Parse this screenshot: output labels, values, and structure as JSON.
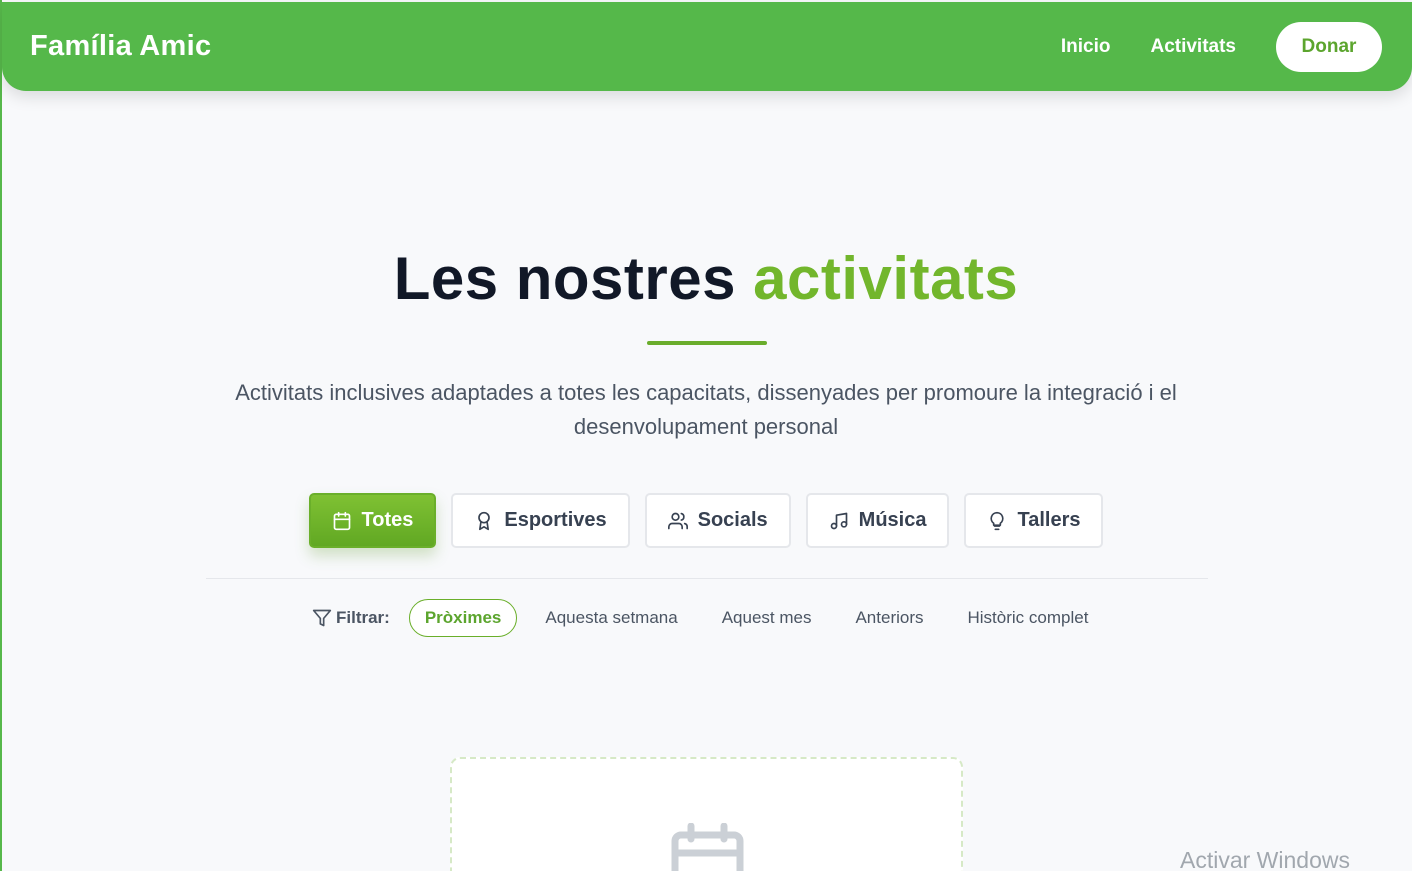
{
  "nav": {
    "brand": "Família Amic",
    "links": [
      "Inicio",
      "Activitats"
    ],
    "donate": "Donar"
  },
  "hero": {
    "title_main": "Les nostres",
    "title_accent": "activitats",
    "subtitle": "Activitats inclusives adaptades a totes les capacitats, dissenyades per promoure la integració i el desenvolupament personal"
  },
  "categories": [
    {
      "label": "Totes",
      "icon": "calendar-icon",
      "active": true
    },
    {
      "label": "Esportives",
      "icon": "award-icon",
      "active": false
    },
    {
      "label": "Socials",
      "icon": "users-icon",
      "active": false
    },
    {
      "label": "Música",
      "icon": "music-icon",
      "active": false
    },
    {
      "label": "Tallers",
      "icon": "lightbulb-icon",
      "active": false
    }
  ],
  "filters": {
    "label": "Filtrar:",
    "options": [
      "Pròximes",
      "Aquesta setmana",
      "Aquest mes",
      "Anteriors",
      "Històric complet"
    ],
    "selected": "Pròximes"
  },
  "empty_state": {
    "icon": "calendar-icon"
  },
  "os_watermark": "Activar Windows",
  "colors": {
    "brand_green": "#55b84a",
    "accent_green": "#72b62c"
  }
}
